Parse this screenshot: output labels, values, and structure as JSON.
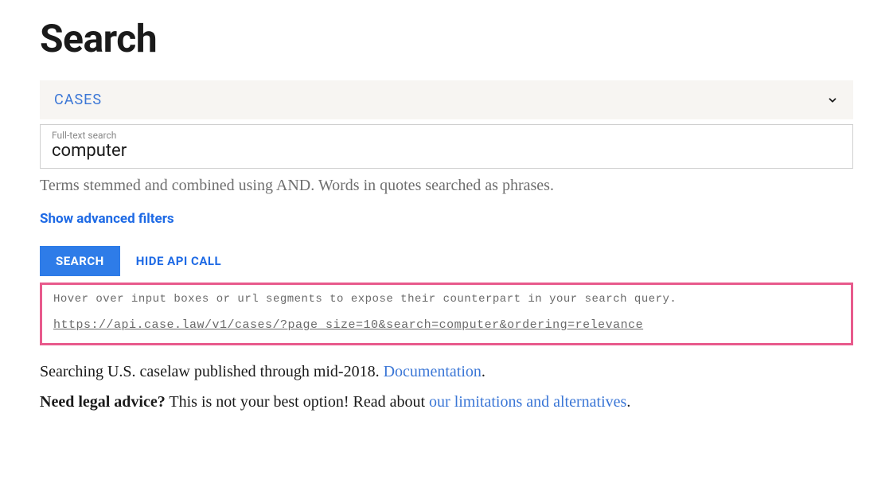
{
  "page_title": "Search",
  "dropdown": {
    "selected": "CASES"
  },
  "search_input": {
    "label": "Full-text search",
    "value": "computer"
  },
  "help_text": "Terms stemmed and combined using AND. Words in quotes searched as phrases.",
  "advanced_filters_label": "Show advanced filters",
  "buttons": {
    "search": "SEARCH",
    "hide_api": "HIDE API CALL"
  },
  "api_box": {
    "hint": "Hover over input boxes or url segments to expose their counterpart in your search query.",
    "url": "https://api.case.law/v1/cases/?page_size=10&search=computer&ordering=relevance"
  },
  "info": {
    "line1_prefix": "Searching U.S. caselaw published through mid-2018. ",
    "documentation_link": "Documentation",
    "line1_suffix": ".",
    "line2_bold": "Need legal advice?",
    "line2_text": " This is not your best option! Read about ",
    "line2_link": "our limitations and alternatives",
    "line2_suffix": "."
  }
}
